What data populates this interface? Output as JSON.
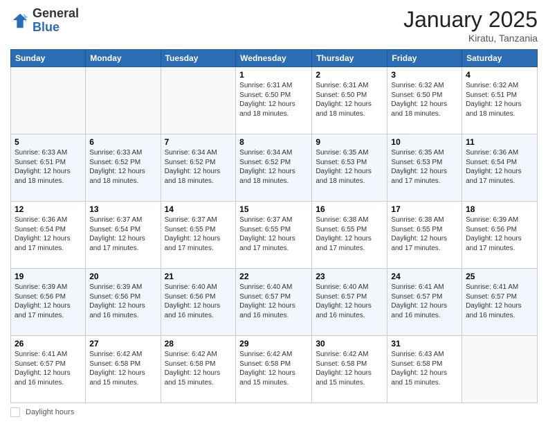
{
  "header": {
    "logo_general": "General",
    "logo_blue": "Blue",
    "month_title": "January 2025",
    "location": "Kiratu, Tanzania"
  },
  "footer": {
    "daylight_label": "Daylight hours"
  },
  "days_of_week": [
    "Sunday",
    "Monday",
    "Tuesday",
    "Wednesday",
    "Thursday",
    "Friday",
    "Saturday"
  ],
  "weeks": [
    [
      {
        "num": "",
        "info": ""
      },
      {
        "num": "",
        "info": ""
      },
      {
        "num": "",
        "info": ""
      },
      {
        "num": "1",
        "info": "Sunrise: 6:31 AM\nSunset: 6:50 PM\nDaylight: 12 hours and 18 minutes."
      },
      {
        "num": "2",
        "info": "Sunrise: 6:31 AM\nSunset: 6:50 PM\nDaylight: 12 hours and 18 minutes."
      },
      {
        "num": "3",
        "info": "Sunrise: 6:32 AM\nSunset: 6:50 PM\nDaylight: 12 hours and 18 minutes."
      },
      {
        "num": "4",
        "info": "Sunrise: 6:32 AM\nSunset: 6:51 PM\nDaylight: 12 hours and 18 minutes."
      }
    ],
    [
      {
        "num": "5",
        "info": "Sunrise: 6:33 AM\nSunset: 6:51 PM\nDaylight: 12 hours and 18 minutes."
      },
      {
        "num": "6",
        "info": "Sunrise: 6:33 AM\nSunset: 6:52 PM\nDaylight: 12 hours and 18 minutes."
      },
      {
        "num": "7",
        "info": "Sunrise: 6:34 AM\nSunset: 6:52 PM\nDaylight: 12 hours and 18 minutes."
      },
      {
        "num": "8",
        "info": "Sunrise: 6:34 AM\nSunset: 6:52 PM\nDaylight: 12 hours and 18 minutes."
      },
      {
        "num": "9",
        "info": "Sunrise: 6:35 AM\nSunset: 6:53 PM\nDaylight: 12 hours and 18 minutes."
      },
      {
        "num": "10",
        "info": "Sunrise: 6:35 AM\nSunset: 6:53 PM\nDaylight: 12 hours and 17 minutes."
      },
      {
        "num": "11",
        "info": "Sunrise: 6:36 AM\nSunset: 6:54 PM\nDaylight: 12 hours and 17 minutes."
      }
    ],
    [
      {
        "num": "12",
        "info": "Sunrise: 6:36 AM\nSunset: 6:54 PM\nDaylight: 12 hours and 17 minutes."
      },
      {
        "num": "13",
        "info": "Sunrise: 6:37 AM\nSunset: 6:54 PM\nDaylight: 12 hours and 17 minutes."
      },
      {
        "num": "14",
        "info": "Sunrise: 6:37 AM\nSunset: 6:55 PM\nDaylight: 12 hours and 17 minutes."
      },
      {
        "num": "15",
        "info": "Sunrise: 6:37 AM\nSunset: 6:55 PM\nDaylight: 12 hours and 17 minutes."
      },
      {
        "num": "16",
        "info": "Sunrise: 6:38 AM\nSunset: 6:55 PM\nDaylight: 12 hours and 17 minutes."
      },
      {
        "num": "17",
        "info": "Sunrise: 6:38 AM\nSunset: 6:55 PM\nDaylight: 12 hours and 17 minutes."
      },
      {
        "num": "18",
        "info": "Sunrise: 6:39 AM\nSunset: 6:56 PM\nDaylight: 12 hours and 17 minutes."
      }
    ],
    [
      {
        "num": "19",
        "info": "Sunrise: 6:39 AM\nSunset: 6:56 PM\nDaylight: 12 hours and 17 minutes."
      },
      {
        "num": "20",
        "info": "Sunrise: 6:39 AM\nSunset: 6:56 PM\nDaylight: 12 hours and 16 minutes."
      },
      {
        "num": "21",
        "info": "Sunrise: 6:40 AM\nSunset: 6:56 PM\nDaylight: 12 hours and 16 minutes."
      },
      {
        "num": "22",
        "info": "Sunrise: 6:40 AM\nSunset: 6:57 PM\nDaylight: 12 hours and 16 minutes."
      },
      {
        "num": "23",
        "info": "Sunrise: 6:40 AM\nSunset: 6:57 PM\nDaylight: 12 hours and 16 minutes."
      },
      {
        "num": "24",
        "info": "Sunrise: 6:41 AM\nSunset: 6:57 PM\nDaylight: 12 hours and 16 minutes."
      },
      {
        "num": "25",
        "info": "Sunrise: 6:41 AM\nSunset: 6:57 PM\nDaylight: 12 hours and 16 minutes."
      }
    ],
    [
      {
        "num": "26",
        "info": "Sunrise: 6:41 AM\nSunset: 6:57 PM\nDaylight: 12 hours and 16 minutes."
      },
      {
        "num": "27",
        "info": "Sunrise: 6:42 AM\nSunset: 6:58 PM\nDaylight: 12 hours and 15 minutes."
      },
      {
        "num": "28",
        "info": "Sunrise: 6:42 AM\nSunset: 6:58 PM\nDaylight: 12 hours and 15 minutes."
      },
      {
        "num": "29",
        "info": "Sunrise: 6:42 AM\nSunset: 6:58 PM\nDaylight: 12 hours and 15 minutes."
      },
      {
        "num": "30",
        "info": "Sunrise: 6:42 AM\nSunset: 6:58 PM\nDaylight: 12 hours and 15 minutes."
      },
      {
        "num": "31",
        "info": "Sunrise: 6:43 AM\nSunset: 6:58 PM\nDaylight: 12 hours and 15 minutes."
      },
      {
        "num": "",
        "info": ""
      }
    ]
  ]
}
